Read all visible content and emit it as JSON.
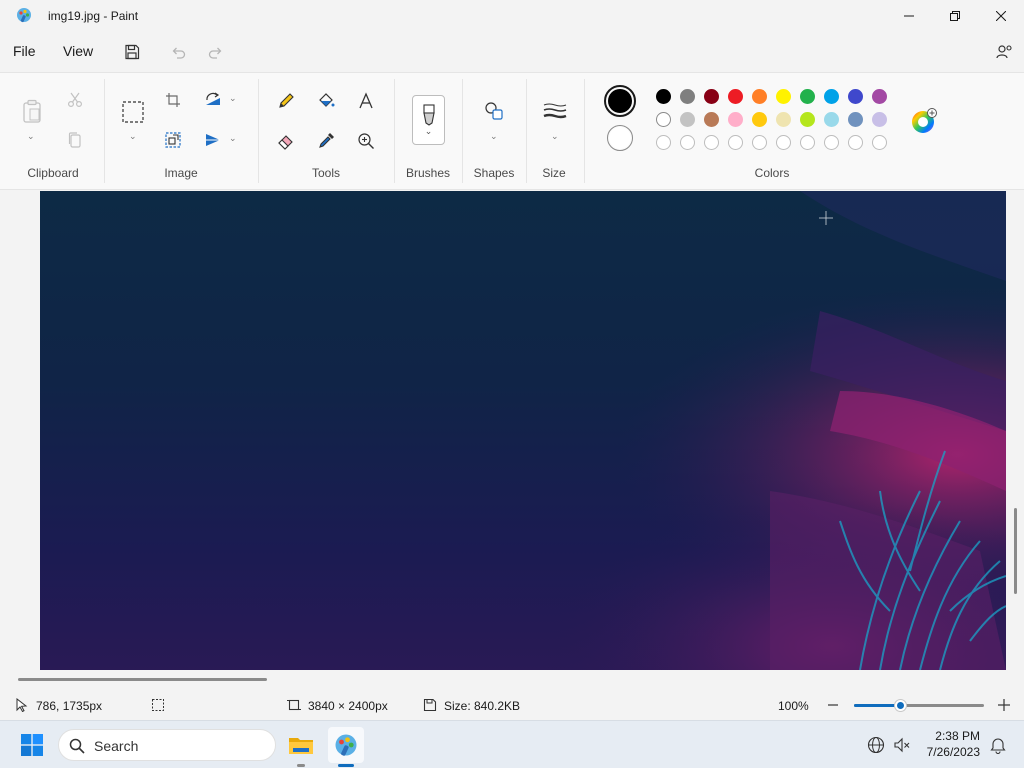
{
  "window": {
    "title": "img19.jpg - Paint"
  },
  "menu": {
    "file": "File",
    "view": "View"
  },
  "ribbon": {
    "groups": {
      "clipboard": "Clipboard",
      "image": "Image",
      "tools": "Tools",
      "brushes": "Brushes",
      "shapes": "Shapes",
      "size": "Size",
      "colors": "Colors"
    },
    "primary_color": "#000000",
    "secondary_color": "#ffffff",
    "palette_row1": [
      "#000000",
      "#7f7f7f",
      "#880015",
      "#ed1c24",
      "#ff7f27",
      "#fff200",
      "#22b14c",
      "#00a2e8",
      "#3f48cc",
      "#a349a4"
    ],
    "palette_row2": [
      "#ffffff",
      "#c3c3c3",
      "#b97a57",
      "#ffaec9",
      "#ffc90e",
      "#efe4b0",
      "#b5e61d",
      "#99d9ea",
      "#7092be",
      "#c8bfe7"
    ]
  },
  "status": {
    "cursor_position": "786, 1735px",
    "image_dimensions": "3840 × 2400px",
    "file_size": "Size: 840.2KB",
    "zoom": "100%",
    "zoom_level": 0.35
  },
  "taskbar": {
    "search_placeholder": "Search",
    "time": "2:38 PM",
    "date": "7/26/2023"
  }
}
